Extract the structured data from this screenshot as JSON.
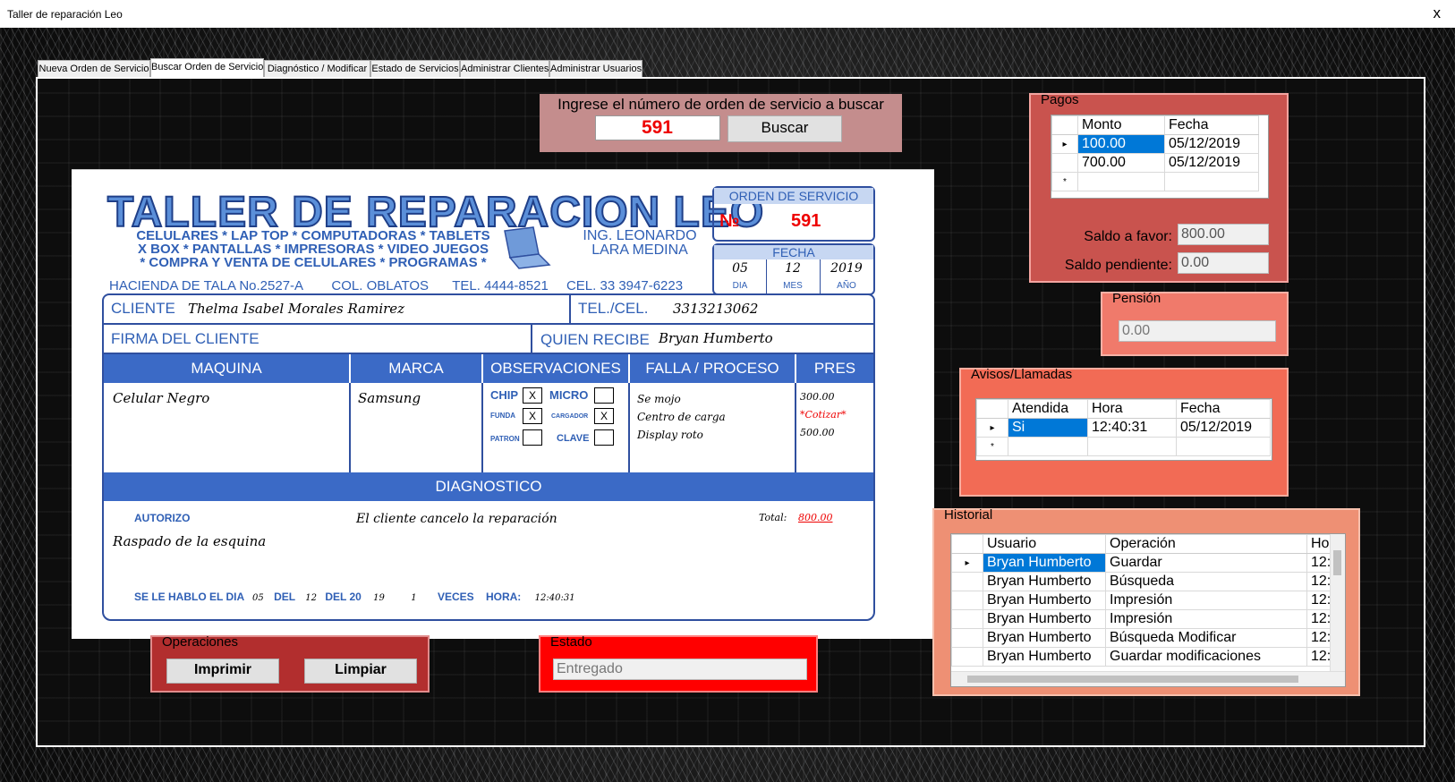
{
  "window": {
    "title": "Taller de reparación Leo",
    "close": "x"
  },
  "tabs": [
    "Nueva Orden de Servicio",
    "Buscar Orden de Servicio",
    "Diagnóstico / Modificar",
    "Estado de Servicios",
    "Administrar Clientes",
    "Administrar Usuarios"
  ],
  "search": {
    "prompt": "Ingrese el número de orden de servicio a buscar",
    "value": "591",
    "button": "Buscar"
  },
  "sheet": {
    "logo": "TALLER DE REPARACION LEO",
    "services": [
      "CELULARES * LAP TOP * COMPUTADORAS * TABLETS",
      "X BOX * PANTALLAS * IMPRESORAS * VIDEO JUEGOS",
      "* COMPRA Y VENTA DE CELULARES * PROGRAMAS *"
    ],
    "owner": [
      "ING. LEONARDO",
      "LARA MEDINA"
    ],
    "address": [
      "HACIENDA DE TALA No.2527-A",
      "COL. OBLATOS",
      "TEL. 4444-8521",
      "CEL. 33 3947-6223"
    ],
    "order_label": "ORDEN DE SERVICIO",
    "order_no_symbol": "№",
    "order_no": "591",
    "date_label": "FECHA",
    "date": {
      "dia": "05",
      "mes": "12",
      "ano": "2019",
      "dia_label": "DIA",
      "mes_label": "MES",
      "ano_label": "AÑO"
    },
    "cliente_label": "CLIENTE",
    "cliente": "Thelma Isabel Morales Ramirez",
    "tel_label": "TEL./CEL.",
    "tel": "3313213062",
    "firma_label": "FIRMA DEL CLIENTE",
    "recibe_label": "QUIEN RECIBE",
    "recibe": "Bryan Humberto",
    "columns": [
      "MAQUINA",
      "MARCA",
      "OBSERVACIONES",
      "FALLA / PROCESO",
      "PRES"
    ],
    "maquina": "Celular Negro",
    "marca": "Samsung",
    "obs": {
      "chip": "CHIP",
      "chip_v": "X",
      "micro": "MICRO",
      "micro_v": "",
      "funda": "FUNDA",
      "funda_v": "X",
      "cargador": "CARGADOR",
      "cargador_v": "X",
      "patron": "PATRON",
      "patron_v": "",
      "clave": "CLAVE",
      "clave_v": ""
    },
    "fallas": [
      "Se mojo",
      "Centro de carga",
      "Display roto"
    ],
    "pres": [
      "300.00",
      "*Cotizar*",
      "500.00"
    ],
    "diag_label": "DIAGNOSTICO",
    "autorizo_label": "AUTORIZO",
    "diagnostico": "El cliente cancelo la reparación",
    "total_label": "Total:",
    "total": "800.00",
    "autorizo": "Raspado de la esquina",
    "footer": {
      "sehablo": "SE LE HABLO EL DIA",
      "dia": "05",
      "del": "DEL",
      "mes": "12",
      "del20": "DEL 20",
      "ano": "19",
      "veces_n": "1",
      "veces": "VECES",
      "hora_label": "HORA:",
      "hora": "12:40:31"
    }
  },
  "pagos": {
    "title": "Pagos",
    "headers": [
      "Monto",
      "Fecha"
    ],
    "rows": [
      [
        "100.00",
        "05/12/2019"
      ],
      [
        "700.00",
        "05/12/2019"
      ]
    ],
    "newrow": "*",
    "row_arrow": "▸",
    "saldo_favor_label": "Saldo a favor:",
    "saldo_favor": "800.00",
    "saldo_pendiente_label": "Saldo pendiente:",
    "saldo_pendiente": "0.00"
  },
  "pension": {
    "title": "Pensión",
    "value": "0.00"
  },
  "avisos": {
    "title": "Avisos/Llamadas",
    "headers": [
      "Atendida",
      "Hora",
      "Fecha"
    ],
    "rows": [
      [
        "Si",
        "12:40:31",
        "05/12/2019"
      ]
    ]
  },
  "historial": {
    "title": "Historial",
    "headers": [
      "Usuario",
      "Operación",
      "Ho"
    ],
    "rows": [
      [
        "Bryan Humberto",
        "Guardar",
        "12:"
      ],
      [
        "Bryan Humberto",
        "Búsqueda",
        "12:"
      ],
      [
        "Bryan Humberto",
        "Impresión",
        "12:"
      ],
      [
        "Bryan Humberto",
        "Impresión",
        "12:"
      ],
      [
        "Bryan Humberto",
        "Búsqueda Modificar",
        "12:"
      ],
      [
        "Bryan Humberto",
        "Guardar modificaciones",
        "12:"
      ]
    ]
  },
  "operaciones": {
    "title": "Operaciones",
    "imprimir": "Imprimir",
    "limpiar": "Limpiar"
  },
  "estado": {
    "title": "Estado",
    "value": "Entregado"
  },
  "colors": {
    "pagos": "#c9534e",
    "pension": "#f07a6b",
    "avisos": "#f26b55",
    "historial": "#ee9074",
    "operaciones": "#b22e2e",
    "estado": "#ff0000",
    "search": "#c48d8d"
  }
}
